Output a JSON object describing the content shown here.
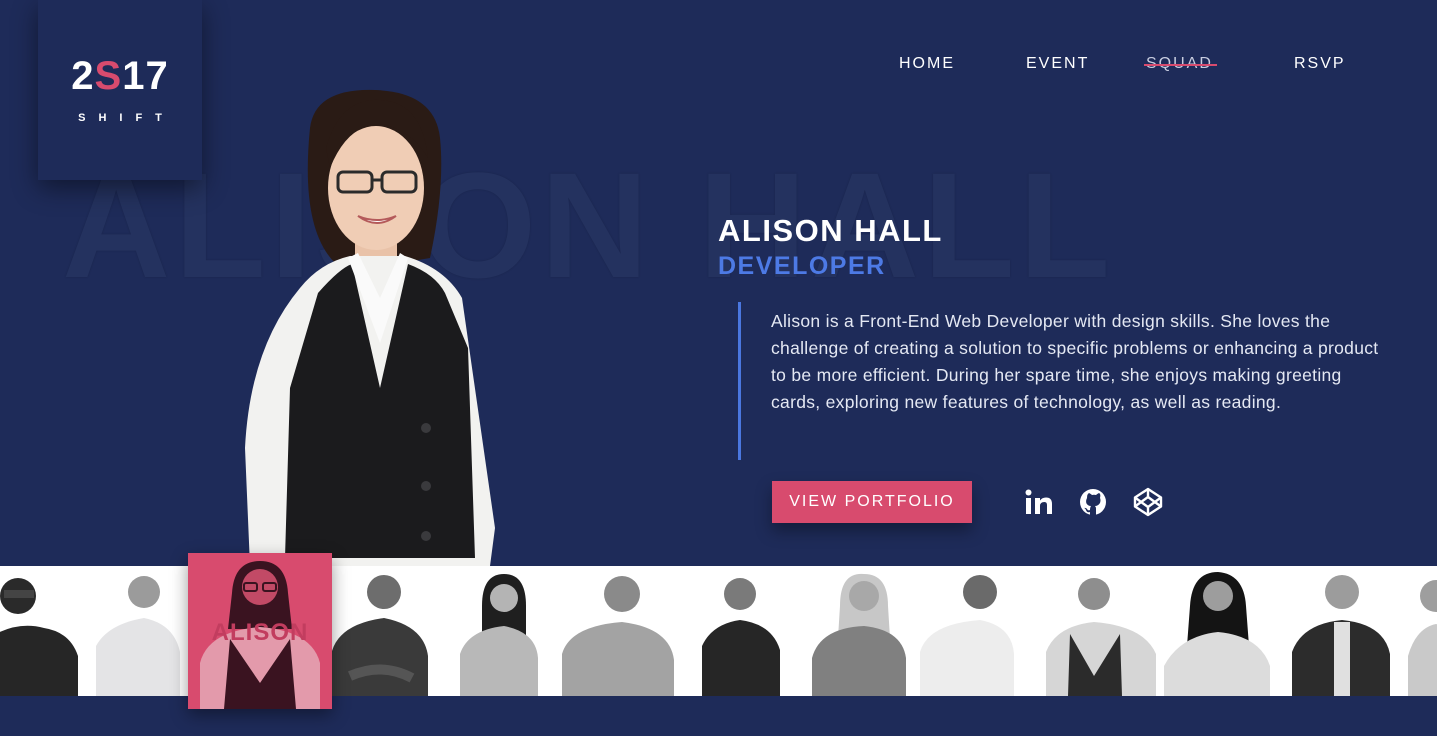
{
  "logo": {
    "year_left": "2",
    "year_accent": "S",
    "year_right": "17",
    "subtitle": "SHIFT"
  },
  "nav": {
    "items": [
      {
        "label": "HOME",
        "active": false
      },
      {
        "label": "EVENT",
        "active": false
      },
      {
        "label": "SQUAD",
        "active": true
      },
      {
        "label": "RSVP",
        "active": false
      }
    ]
  },
  "background_name": "ALISON HALL",
  "profile": {
    "name": "ALISON HALL",
    "role": "DEVELOPER",
    "bio": "Alison is a Front-End Web Developer with design skills. She loves the challenge of creating a solution to specific problems or enhancing a product to be more efficient. During her spare time, she enjoys making greeting cards, exploring new features of technology, as well as reading.",
    "portfolio_button": "VIEW PORTFOLIO",
    "social": [
      "linkedin-icon",
      "github-icon",
      "codepen-icon"
    ]
  },
  "squad_strip": {
    "selected_label": "ALISON",
    "member_count": 14
  },
  "colors": {
    "background": "#1e2b59",
    "accent_pink": "#d84b6e",
    "accent_blue": "#4d7ae5"
  }
}
